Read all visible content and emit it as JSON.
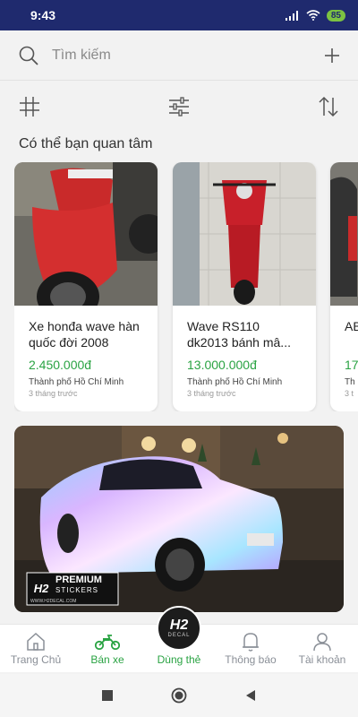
{
  "status_bar": {
    "time": "9:43",
    "battery": "85"
  },
  "search": {
    "placeholder": "Tìm kiếm"
  },
  "section": {
    "title": "Có thể bạn quan tâm"
  },
  "listings": [
    {
      "title": "Xe honđa wave hàn quốc đời 2008",
      "price": "2.450.000đ",
      "location": "Thành phố Hồ Chí Minh",
      "time": "3 tháng trước"
    },
    {
      "title": "Wave RS110 dk2013 bánh mâ...",
      "price": "13.000.000đ",
      "location": "Thành phố Hồ Chí Minh",
      "time": "3 tháng trước"
    },
    {
      "title": "AB",
      "price": "17",
      "location": "Th",
      "time": "3 t"
    }
  ],
  "banner": {
    "logo_brand": "H2",
    "logo_title": "PREMIUM",
    "logo_subtitle": "STICKERS",
    "logo_url": "WWW.H2DECAL.COM"
  },
  "nav": {
    "items": [
      {
        "label": "Trang Chủ",
        "icon": "home-icon"
      },
      {
        "label": "Bán xe",
        "icon": "motorbike-icon"
      },
      {
        "label": "Dùng thẻ",
        "icon": "h2-decal-badge"
      },
      {
        "label": "Thông báo",
        "icon": "bell-icon"
      },
      {
        "label": "Tài khoản",
        "icon": "user-icon"
      }
    ],
    "badge_text": "H2",
    "badge_sub": "DECAL"
  },
  "colors": {
    "status_bar": "#1f2a6e",
    "accent_green": "#2aa343",
    "muted": "#8a8f97"
  }
}
